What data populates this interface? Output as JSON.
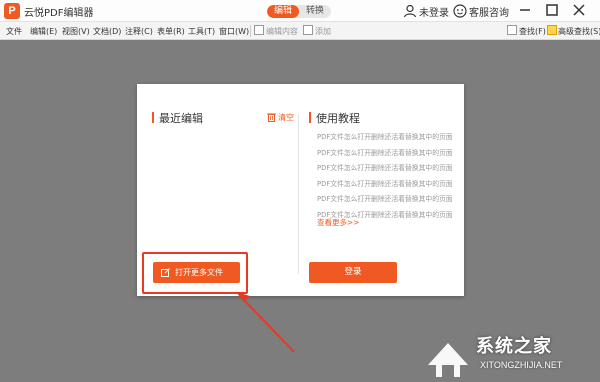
{
  "app": {
    "logo_letter": "P",
    "title": "云悦PDF编辑器",
    "modes": [
      "编辑",
      "转换"
    ],
    "login_label": "未登录",
    "help_label": "客服咨询"
  },
  "menu": {
    "items": [
      "文件",
      "编辑(E)",
      "视图(V)",
      "文档(D)",
      "注释(C)",
      "表单(R)",
      "工具(T)",
      "窗口(W)"
    ],
    "edit_content_label": "编辑内容",
    "add_label": "添加",
    "find_label": "查找(F)",
    "advanced_find_label": "高级查找(S)"
  },
  "dialog": {
    "recent_title": "最近编辑",
    "clear_label": "清空",
    "tutorial_title": "使用教程",
    "tutorials": [
      "PDF文件怎么打开删除还活着替换其中的页面",
      "PDF文件怎么打开删除还活着替换其中的页面",
      "PDF文件怎么打开删除还活着替换其中的页面",
      "PDF文件怎么打开删除还活着替换其中的页面",
      "PDF文件怎么打开删除还活着替换其中的页面",
      "PDF文件怎么打开删除还活着替换其中的页面"
    ],
    "view_more": "查看更多>>",
    "open_more_label": "打开更多文件",
    "login_button": "登录"
  },
  "watermark": {
    "title": "系统之家",
    "url": "XITONGZHIJIA.NET"
  },
  "colors": {
    "accent": "#f05a22",
    "highlight_red": "#e63a21",
    "workspace": "#7d7d7d"
  },
  "icons": [
    "app-logo",
    "user-icon",
    "help-icon",
    "minimize-icon",
    "maximize-icon",
    "close-icon",
    "trash-icon",
    "open-file-icon",
    "arrow-annotation"
  ]
}
